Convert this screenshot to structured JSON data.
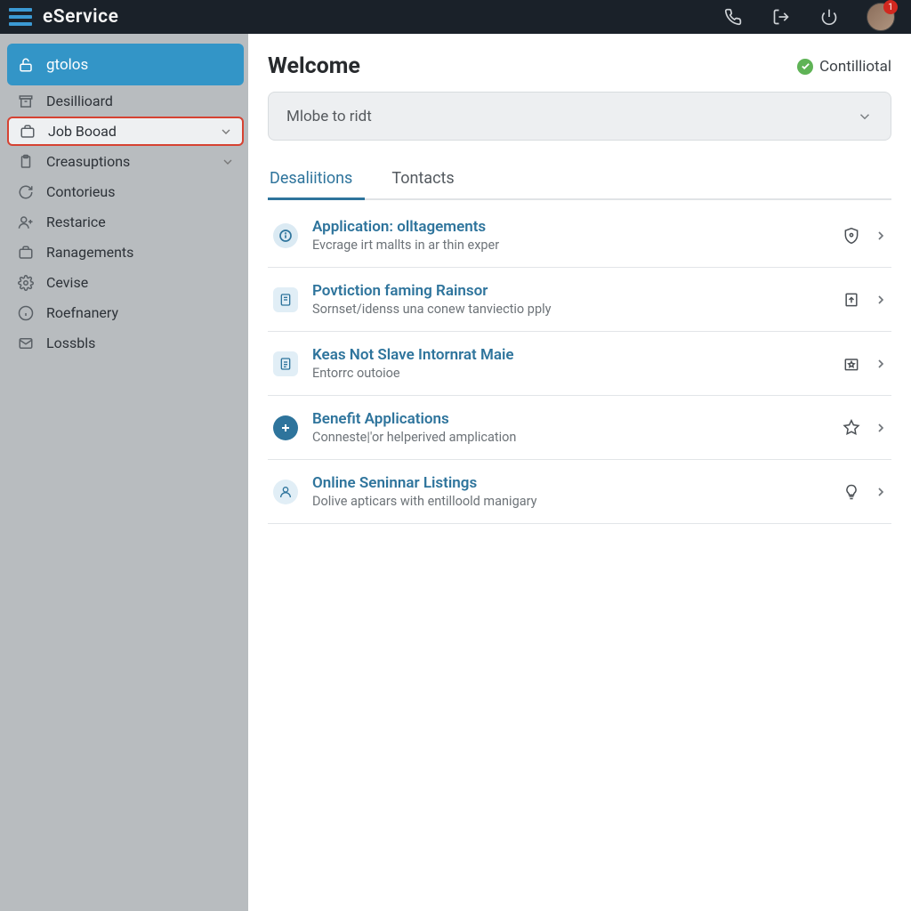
{
  "brand": "eService",
  "avatar_badge": "1",
  "sidebar": {
    "header": {
      "label": "gtolos",
      "icon": "lock-open"
    },
    "items": [
      {
        "label": "Desillioard",
        "icon": "archive",
        "chevron": false,
        "highlight": false
      },
      {
        "label": "Job Booad",
        "icon": "briefcase",
        "chevron": true,
        "highlight": true
      },
      {
        "label": "Creasuptions",
        "icon": "clipboard",
        "chevron": true,
        "highlight": false
      },
      {
        "label": "Contorieus",
        "icon": "refresh",
        "chevron": false,
        "highlight": false
      },
      {
        "label": "Restarice",
        "icon": "plus-person",
        "chevron": false,
        "highlight": false
      },
      {
        "label": "Ranagements",
        "icon": "briefcase",
        "chevron": false,
        "highlight": false
      },
      {
        "label": "Cevise",
        "icon": "gear",
        "chevron": false,
        "highlight": false
      },
      {
        "label": "Roefnanery",
        "icon": "info",
        "chevron": false,
        "highlight": false
      },
      {
        "label": "Lossbls",
        "icon": "mail",
        "chevron": false,
        "highlight": false
      }
    ]
  },
  "main": {
    "welcome": "Welcome",
    "status": "Contilliotal",
    "accordion": "Mlobe to ridt",
    "tabs": [
      {
        "label": "Desaliitions",
        "active": true
      },
      {
        "label": "Tontacts",
        "active": false
      }
    ],
    "rows": [
      {
        "icon": "info",
        "title": "Application: olltagements",
        "sub": "Evcrage irt mallts in ar thin exper",
        "action_icon": "shield"
      },
      {
        "icon": "doc-lines",
        "title": "Povtiction faming Rainsor",
        "sub": "Sornset/idenss una conew tanviectio pply",
        "action_icon": "doc-up"
      },
      {
        "icon": "doc",
        "title": "Keas Not Slave Intornrat Maie",
        "sub": "Entorrc outoioe",
        "action_icon": "star-box"
      },
      {
        "icon": "plus",
        "title": "Benefit Applications",
        "sub": "Conneste|'or helperived amplication",
        "action_icon": "star"
      },
      {
        "icon": "user",
        "title": "Online Seninnar Listings",
        "sub": "Dolive apticars with entilloold manigary",
        "action_icon": "bulb"
      }
    ]
  },
  "colors": {
    "accent": "#2e749c",
    "sidebar_active": "#3395c7",
    "bg_sidebar": "#b8bcbf"
  }
}
